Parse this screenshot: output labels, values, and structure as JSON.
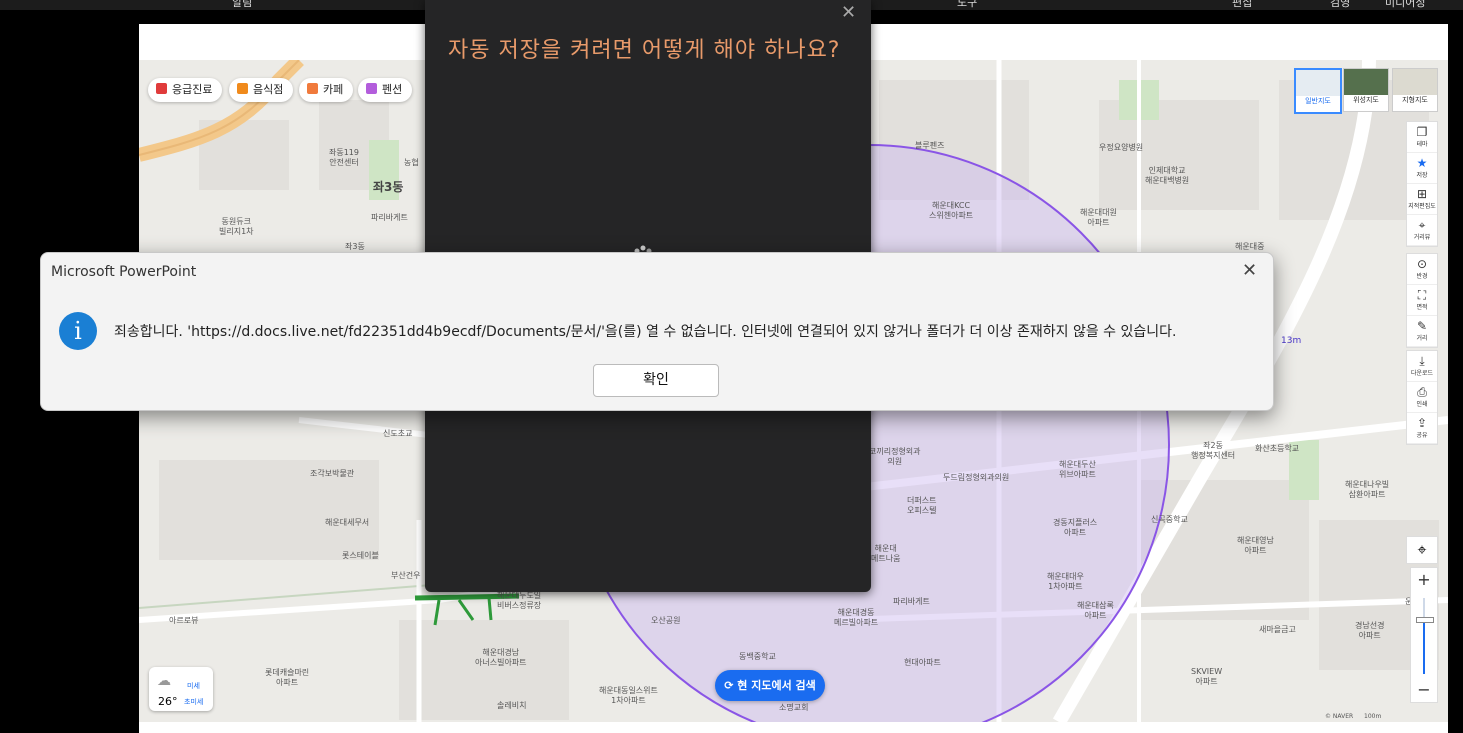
{
  "taskbar": {
    "items": [
      "알림",
      "도구",
      "편집",
      "검영",
      "미디어정"
    ]
  },
  "map": {
    "categories": [
      {
        "label": "응급진료",
        "color": "#e03b3b"
      },
      {
        "label": "음식점",
        "color": "#f08a1c"
      },
      {
        "label": "카페",
        "color": "#f07a3c"
      },
      {
        "label": "펜션",
        "color": "#b35ddc"
      }
    ],
    "map_types": [
      "일반지도",
      "위성지도",
      "지형지도"
    ],
    "tools": [
      {
        "label": "테마",
        "icon": "layers-icon"
      },
      {
        "label": "저장",
        "icon": "star-icon"
      },
      {
        "label": "지적편집도",
        "icon": "grid-icon"
      },
      {
        "label": "거리뷰",
        "icon": "pin-icon"
      },
      {
        "label": "반경",
        "icon": "target-icon"
      },
      {
        "label": "면적",
        "icon": "square-icon"
      },
      {
        "label": "거리",
        "icon": "ruler-icon"
      },
      {
        "label": "다운로드",
        "icon": "download-icon"
      },
      {
        "label": "인쇄",
        "icon": "print-icon"
      },
      {
        "label": "공유",
        "icon": "share-icon"
      }
    ],
    "place_labels": [
      "좌동119\n안전센터",
      "농협",
      "좌3동",
      "파리바게트",
      "동원듀크\n빌리지1차",
      "좌3동",
      "블루펜즈",
      "해운대KCC\n스위첸아파트",
      "해운대대원\n아파트",
      "우정요양병원",
      "인제대학교\n해운대백병원",
      "해운대중",
      "신도초교",
      "조각보박물관",
      "해운대세무서",
      "롯스테이블",
      "부산건우",
      "아르로뷰",
      "해운대두도일\n비버스정류장",
      "오산공원",
      "해운대경남\n아너스빌아파트",
      "해운대경동\n메르빌아파트",
      "롯데캐슬마린\n아파트",
      "솔레비치",
      "해운대동일스위트\n1차아파트",
      "동백중학교",
      "현대아파트",
      "소명교회",
      "코끼리정형외과\n의원",
      "두드림정형외과의원",
      "더퍼스트\n오피스텔",
      "해운대\n메트나움",
      "파리바게트",
      "경동지플러스\n아파트",
      "해운대대우\n1차아파트",
      "해운대두산\n위브아파트",
      "좌2동\n행정복지센터",
      "화산초등학교",
      "신곡중학교",
      "해운대영남\n아파트",
      "해운대삼록\n아파트",
      "해운대나우빌\n삼환아파트",
      "새마을금고",
      "경남선경\n아파트",
      "운동장",
      "SKVIEW\n아파트"
    ],
    "weather": {
      "temp": "26°",
      "dust1": "미세",
      "dust2": "초미세"
    },
    "search_here": "현 지도에서 검색",
    "radius_label": "13m",
    "naver": "© NAVER",
    "scale": "100m"
  },
  "help_popup": {
    "title": "자동 저장을 켜려면 어떻게 해야 하나요?"
  },
  "dialog": {
    "title": "Microsoft PowerPoint",
    "message": "죄송합니다. 'https://d.docs.live.net/fd22351dd4b9ecdf/Documents/문서/'을(를) 열 수 없습니다. 인터넷에 연결되어 있지 않거나 폴더가 더 이상 존재하지 않을 수 있습니다.",
    "ok": "확인"
  }
}
